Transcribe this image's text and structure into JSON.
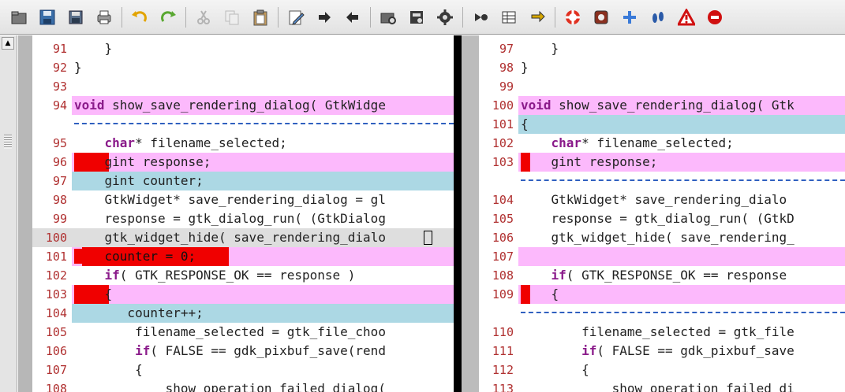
{
  "toolbar": {
    "buttons": [
      {
        "name": "open-folder-icon"
      },
      {
        "name": "save-icon"
      },
      {
        "name": "save-all-icon"
      },
      {
        "name": "print-icon"
      },
      {
        "sep": true
      },
      {
        "name": "undo-icon"
      },
      {
        "name": "redo-icon"
      },
      {
        "sep": true
      },
      {
        "name": "cut-icon"
      },
      {
        "name": "copy-icon"
      },
      {
        "name": "paste-icon"
      },
      {
        "sep": true
      },
      {
        "name": "edit-icon"
      },
      {
        "name": "next-difference-icon"
      },
      {
        "name": "previous-difference-icon"
      },
      {
        "sep": true
      },
      {
        "name": "folder-compare-icon"
      },
      {
        "name": "options-icon"
      },
      {
        "name": "settings-icon"
      },
      {
        "sep": true
      },
      {
        "name": "merge-icon"
      },
      {
        "name": "table-icon"
      },
      {
        "name": "sync-icon"
      },
      {
        "sep": true
      },
      {
        "name": "help-icon"
      },
      {
        "name": "bug-icon"
      },
      {
        "name": "add-icon"
      },
      {
        "name": "footprints-icon"
      },
      {
        "name": "warning-icon"
      },
      {
        "name": "stop-icon"
      }
    ]
  },
  "colors": {
    "changed": "#fcb9fc",
    "moved": "#acd8e4",
    "marker": "#f00000",
    "line_number": "#b03030",
    "keyword": "#8a1a8a",
    "divider": "#000000"
  },
  "left": [
    {
      "ln": "91",
      "style": "",
      "tokens": [
        {
          "t": "    }"
        }
      ]
    },
    {
      "ln": "92",
      "style": "",
      "tokens": [
        {
          "t": "}"
        }
      ]
    },
    {
      "ln": "93",
      "style": "",
      "tokens": [
        {
          "t": ""
        }
      ]
    },
    {
      "ln": "94",
      "style": "pink",
      "tokens": [
        {
          "t": "void",
          "k": "kw"
        },
        {
          "t": " show_save_rendering_dialog( GtkWidge"
        }
      ]
    },
    {
      "ln": "",
      "style": "dash",
      "tokens": []
    },
    {
      "ln": "95",
      "style": "",
      "tokens": [
        {
          "t": "    "
        },
        {
          "t": "char",
          "k": "kw"
        },
        {
          "t": "* filename_selected;"
        }
      ]
    },
    {
      "ln": "96",
      "style": "pink",
      "mark": [
        0,
        44
      ],
      "tokens": [
        {
          "t": "    gint response;"
        }
      ]
    },
    {
      "ln": "97",
      "style": "blue",
      "tokens": [
        {
          "t": "    gint counter;"
        }
      ]
    },
    {
      "ln": "98",
      "style": "",
      "tokens": [
        {
          "t": "    GtkWidget* save_rendering_dialog = gl"
        }
      ]
    },
    {
      "ln": "99",
      "style": "",
      "tokens": [
        {
          "t": "    response = gtk_dialog_run( (GtkDialog"
        }
      ]
    },
    {
      "ln": "100",
      "style": "gray",
      "lnsel": true,
      "cursor": true,
      "tokens": [
        {
          "t": "    gtk_widget_hide( save_rendering_dia"
        },
        {
          "t": "l"
        },
        {
          "t": "o"
        }
      ]
    },
    {
      "ln": "101",
      "style": "pink",
      "mark": [
        10,
        186
      ],
      "tokens": [
        {
          "t": "    counter = 0;",
          "k": "strike"
        }
      ]
    },
    {
      "ln": "102",
      "style": "",
      "tokens": [
        {
          "t": "    "
        },
        {
          "t": "if",
          "k": "kw"
        },
        {
          "t": "( GTK_RESPONSE_OK == response )"
        }
      ]
    },
    {
      "ln": "103",
      "style": "pink",
      "mark": [
        0,
        44
      ],
      "tokens": [
        {
          "t": "    {"
        }
      ]
    },
    {
      "ln": "104",
      "style": "blue",
      "tokens": [
        {
          "t": "       counter++;"
        }
      ]
    },
    {
      "ln": "105",
      "style": "",
      "tokens": [
        {
          "t": "        filename_selected = gtk_file_choo"
        }
      ]
    },
    {
      "ln": "106",
      "style": "",
      "tokens": [
        {
          "t": "        "
        },
        {
          "t": "if",
          "k": "kw"
        },
        {
          "t": "( FALSE == gdk_pixbuf_save(rend"
        }
      ]
    },
    {
      "ln": "107",
      "style": "",
      "tokens": [
        {
          "t": "        {"
        }
      ]
    },
    {
      "ln": "108",
      "style": "",
      "tokens": [
        {
          "t": "            show_operation_failed_dialog("
        }
      ]
    }
  ],
  "right": [
    {
      "ln": "97",
      "style": "",
      "tokens": [
        {
          "t": "    }"
        }
      ]
    },
    {
      "ln": "98",
      "style": "",
      "tokens": [
        {
          "t": "}"
        }
      ]
    },
    {
      "ln": "99",
      "style": "",
      "tokens": [
        {
          "t": ""
        }
      ]
    },
    {
      "ln": "100",
      "style": "pink",
      "tokens": [
        {
          "t": "void",
          "k": "kw"
        },
        {
          "t": " show_save_rendering_dialog( Gtk"
        }
      ]
    },
    {
      "ln": "101",
      "style": "blue",
      "tokens": [
        {
          "t": "{"
        }
      ]
    },
    {
      "ln": "102",
      "style": "",
      "tokens": [
        {
          "t": "    "
        },
        {
          "t": "char",
          "k": "kw"
        },
        {
          "t": "* filename_selected;"
        }
      ]
    },
    {
      "ln": "103",
      "style": "pink",
      "mark": [
        0,
        12
      ],
      "tokens": [
        {
          "t": "    gint response;"
        }
      ]
    },
    {
      "ln": "",
      "style": "dash",
      "tokens": []
    },
    {
      "ln": "104",
      "style": "",
      "tokens": [
        {
          "t": "    GtkWidget* save_rendering_dialo"
        }
      ]
    },
    {
      "ln": "105",
      "style": "",
      "tokens": [
        {
          "t": "    response = gtk_dialog_run( (GtkD"
        }
      ]
    },
    {
      "ln": "106",
      "style": "",
      "tokens": [
        {
          "t": "    gtk_widget_hide( save_rendering_"
        }
      ]
    },
    {
      "ln": "107",
      "style": "pink",
      "tokens": [
        {
          "t": ""
        }
      ]
    },
    {
      "ln": "108",
      "style": "",
      "tokens": [
        {
          "t": "    "
        },
        {
          "t": "if",
          "k": "kw"
        },
        {
          "t": "( GTK_RESPONSE_OK == response "
        }
      ]
    },
    {
      "ln": "109",
      "style": "pink",
      "mark": [
        0,
        12
      ],
      "tokens": [
        {
          "t": "    {"
        }
      ]
    },
    {
      "ln": "",
      "style": "dash",
      "tokens": []
    },
    {
      "ln": "110",
      "style": "",
      "tokens": [
        {
          "t": "        filename_selected = gtk_file"
        }
      ]
    },
    {
      "ln": "111",
      "style": "",
      "tokens": [
        {
          "t": "        "
        },
        {
          "t": "if",
          "k": "kw"
        },
        {
          "t": "( FALSE == gdk_pixbuf_save"
        }
      ]
    },
    {
      "ln": "112",
      "style": "",
      "tokens": [
        {
          "t": "        {"
        }
      ]
    },
    {
      "ln": "113",
      "style": "",
      "tokens": [
        {
          "t": "            show_operation_failed_di"
        }
      ]
    }
  ]
}
